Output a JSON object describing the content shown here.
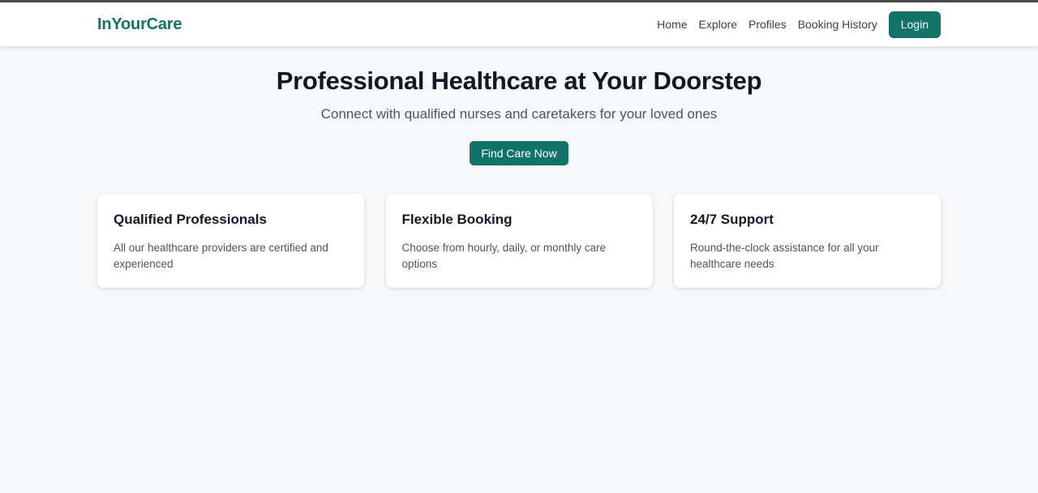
{
  "navbar": {
    "brand": "InYourCare",
    "links": [
      "Home",
      "Explore",
      "Profiles",
      "Booking History"
    ],
    "login_label": "Login"
  },
  "hero": {
    "title": "Professional Healthcare at Your Doorstep",
    "subtitle": "Connect with qualified nurses and caretakers for your loved ones",
    "cta_label": "Find Care Now"
  },
  "features": [
    {
      "title": "Qualified Professionals",
      "description": "All our healthcare providers are certified and experienced"
    },
    {
      "title": "Flexible Booking",
      "description": "Choose from hourly, daily, or monthly care options"
    },
    {
      "title": "24/7 Support",
      "description": "Round-the-clock assistance for all your healthcare needs"
    }
  ],
  "colors": {
    "brand": "#127468",
    "background": "#f7f8fa",
    "text": "#111827",
    "muted_text": "#4b5563"
  }
}
